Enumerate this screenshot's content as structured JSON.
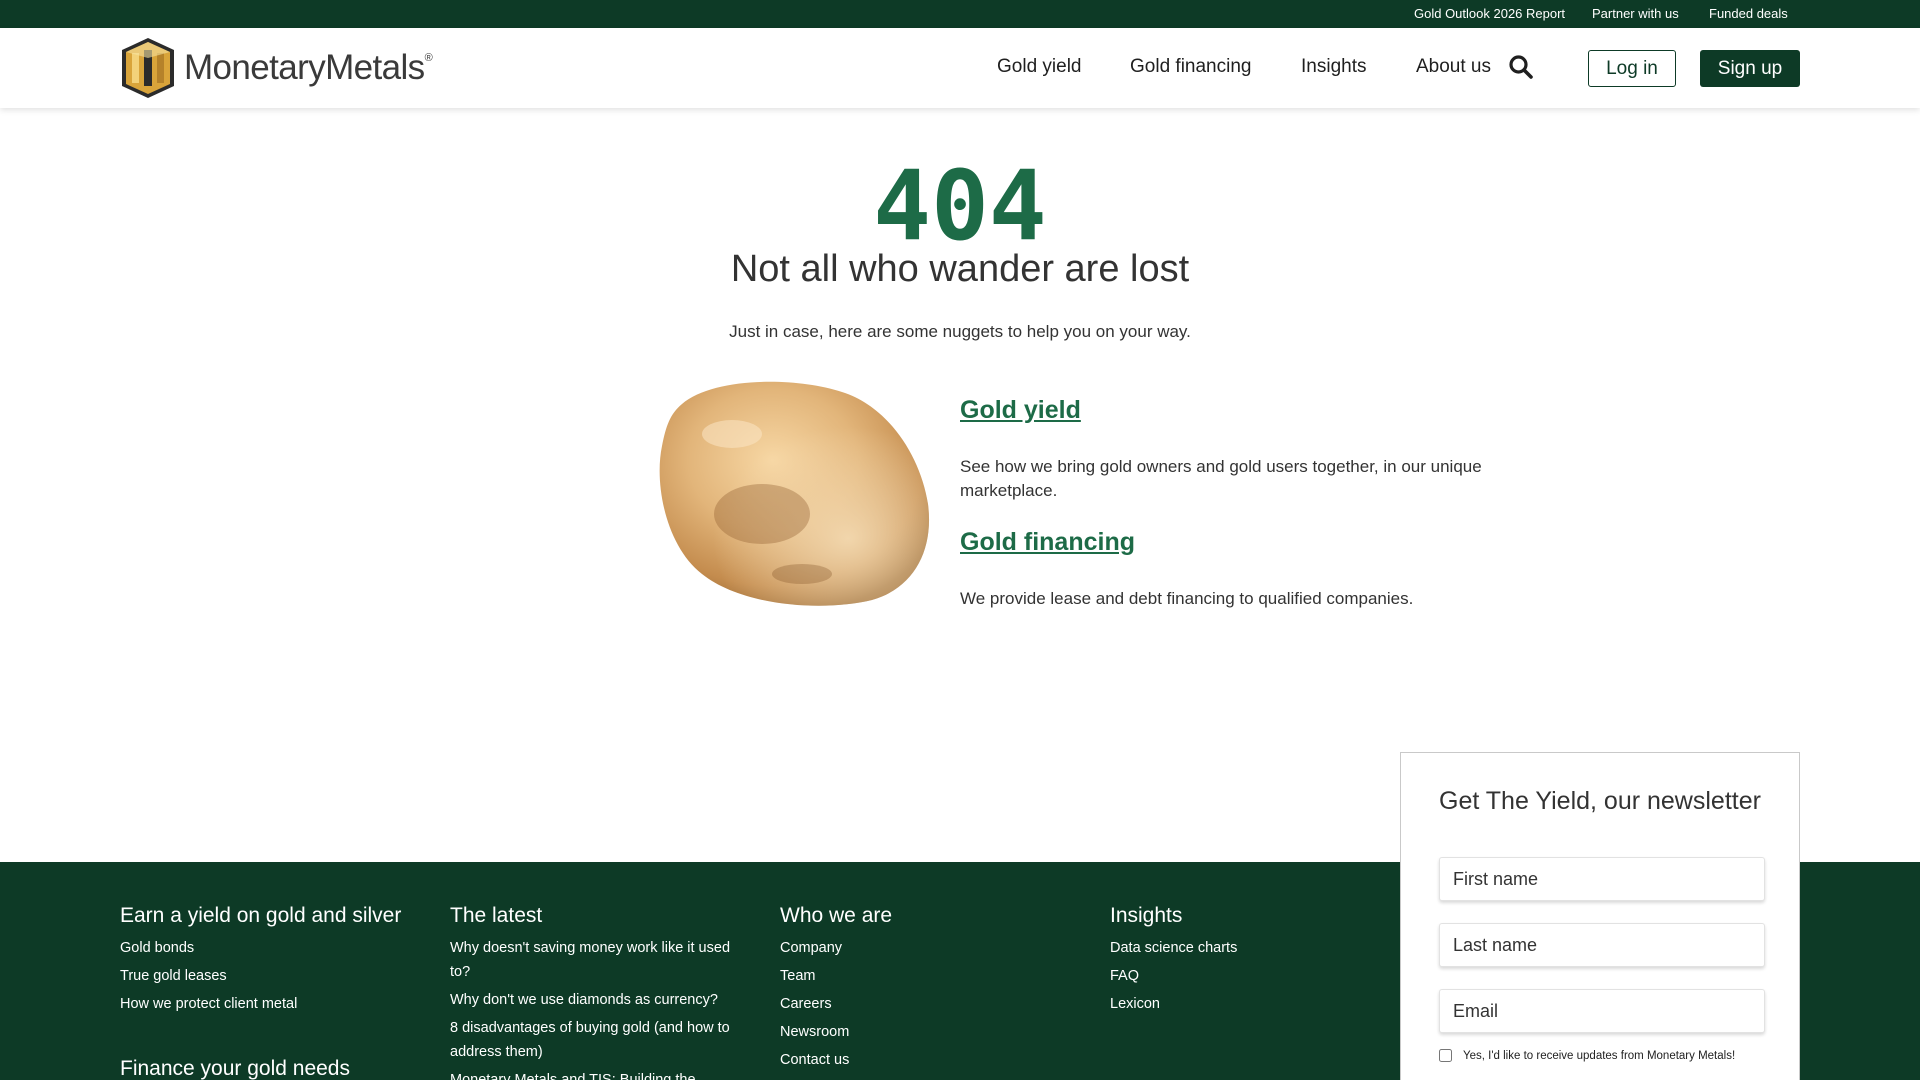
{
  "topbar": {
    "links": [
      "Gold Outlook 2026 Report",
      "Partner with us",
      "Funded deals"
    ]
  },
  "header": {
    "logo_text": "MonetaryMetals",
    "logo_mark": "®",
    "nav": [
      "Gold yield",
      "Gold financing",
      "Insights",
      "About us"
    ],
    "search_icon": "search-icon",
    "login_label": "Log in",
    "signup_label": "Sign up"
  },
  "main": {
    "code": "404",
    "heading": "Not all who wander are lost",
    "subtext": "Just in case, here are some nuggets to help you on your way.",
    "links": [
      {
        "title": "Gold yield",
        "description": "See how we bring gold owners and gold users together, in our unique marketplace."
      },
      {
        "title": "Gold financing",
        "description": "We provide lease and debt financing to qualified companies."
      }
    ]
  },
  "footer": {
    "columns": [
      {
        "title": "Earn a yield on gold and silver",
        "links": [
          "Gold bonds",
          "True gold leases",
          "How we protect client metal"
        ]
      },
      {
        "title": "The latest",
        "links": [
          "Why doesn't saving money work like it used to?",
          "Why don't we use diamonds as currency?",
          "8 disadvantages of buying gold (and how to address them)",
          "Monetary Metals and TIS: Building the"
        ]
      },
      {
        "title": "Who we are",
        "links": [
          "Company",
          "Team",
          "Careers",
          "Newsroom",
          "Contact us"
        ]
      },
      {
        "title": "Insights",
        "links": [
          "Data science charts",
          "FAQ",
          "Lexicon"
        ]
      }
    ],
    "second_title": "Finance your gold needs"
  },
  "newsletter": {
    "title": "Get The Yield, our newsletter",
    "first_name_placeholder": "First name",
    "last_name_placeholder": "Last name",
    "email_placeholder": "Email",
    "consent_label": "Yes, I'd like to receive updates from Monetary Metals!"
  },
  "colors": {
    "brand_dark": "#0d3a26",
    "accent_green": "#1d6b47",
    "gold": "#c9a35c"
  }
}
